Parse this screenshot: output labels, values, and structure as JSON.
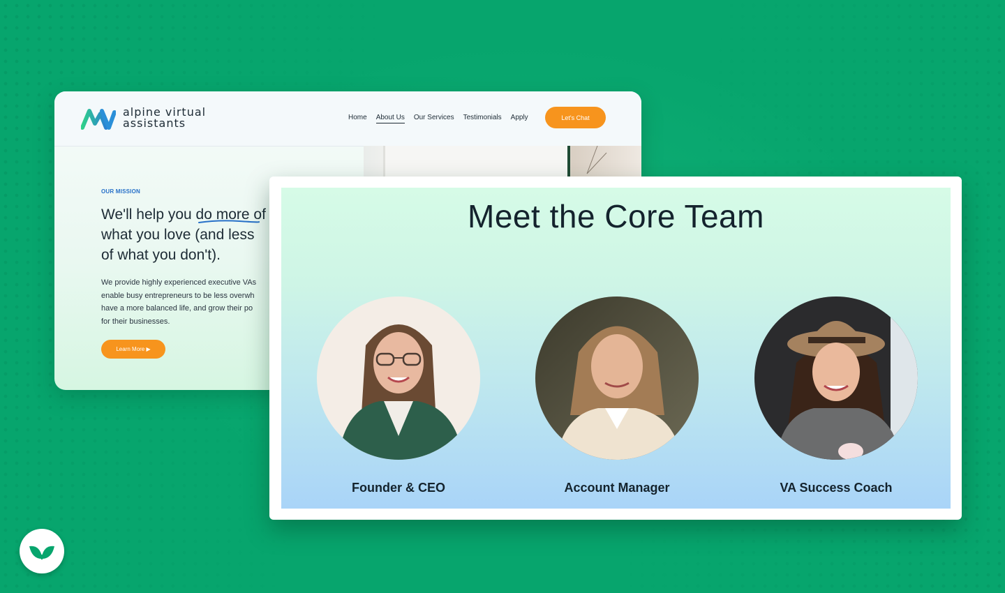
{
  "brand": {
    "name_line1": "alpine virtual",
    "name_line2": "assistants",
    "accent_orange": "#f7941d",
    "accent_blue": "#2770c8",
    "background_green": "#07a56d"
  },
  "nav": {
    "items": [
      "Home",
      "About Us",
      "Our Services",
      "Testimonials",
      "Apply"
    ],
    "active": "About Us",
    "cta_label": "Let's Chat"
  },
  "mission": {
    "label": "OUR MISSION",
    "heading_line1": "We'll help you do more of",
    "heading_line2": "what you love (and less",
    "heading_line3": "of what you don't).",
    "body_line1": "We provide highly experienced executive VAs",
    "body_line2": "enable busy entrepreneurs to be less overwh",
    "body_line3": "have a more balanced life, and grow their po",
    "body_line4": "for their businesses.",
    "button_label": "Learn More ▶"
  },
  "team": {
    "title": "Meet the Core Team",
    "members": [
      {
        "role": "Founder & CEO"
      },
      {
        "role": "Account Manager"
      },
      {
        "role": "VA Success Coach"
      }
    ]
  },
  "badge": {
    "icon": "leaf-icon"
  }
}
